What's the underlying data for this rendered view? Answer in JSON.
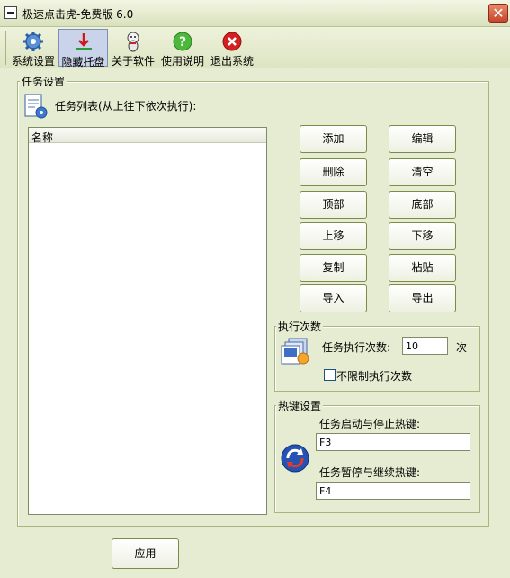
{
  "window": {
    "title": "极速点击虎-免费版 6.0",
    "close_glyph": "✕"
  },
  "toolbar": {
    "items": [
      {
        "label": "系统设置",
        "icon": "gear-icon"
      },
      {
        "label": "隐藏托盘",
        "icon": "download-tray-icon"
      },
      {
        "label": "关于软件",
        "icon": "mascot-icon"
      },
      {
        "label": "使用说明",
        "icon": "help-icon"
      },
      {
        "label": "退出系统",
        "icon": "exit-icon"
      }
    ]
  },
  "task_settings": {
    "group_title": "任务设置",
    "list_title": "任务列表(从上往下依次执行):",
    "list": {
      "column": "名称",
      "rows": []
    },
    "buttons": {
      "add": "添加",
      "edit": "编辑",
      "delete": "删除",
      "clear": "清空",
      "top": "顶部",
      "bottom": "底部",
      "up": "上移",
      "down": "下移",
      "copy": "复制",
      "paste": "粘贴",
      "import": "导入",
      "export": "导出"
    }
  },
  "exec_count": {
    "group_title": "执行次数",
    "label": "任务执行次数:",
    "value": "10",
    "unit": "次",
    "unlimited_label": "不限制执行次数",
    "unlimited_checked": false
  },
  "hotkeys": {
    "group_title": "热键设置",
    "start_stop_label": "任务启动与停止热键:",
    "start_stop_value": "F3",
    "pause_resume_label": "任务暂停与继续热键:",
    "pause_resume_value": "F4"
  },
  "apply_button": "应用",
  "colors": {
    "window_bg": "#e6ecd2",
    "border": "#a9b57e",
    "button_border": "#7b8a46"
  }
}
